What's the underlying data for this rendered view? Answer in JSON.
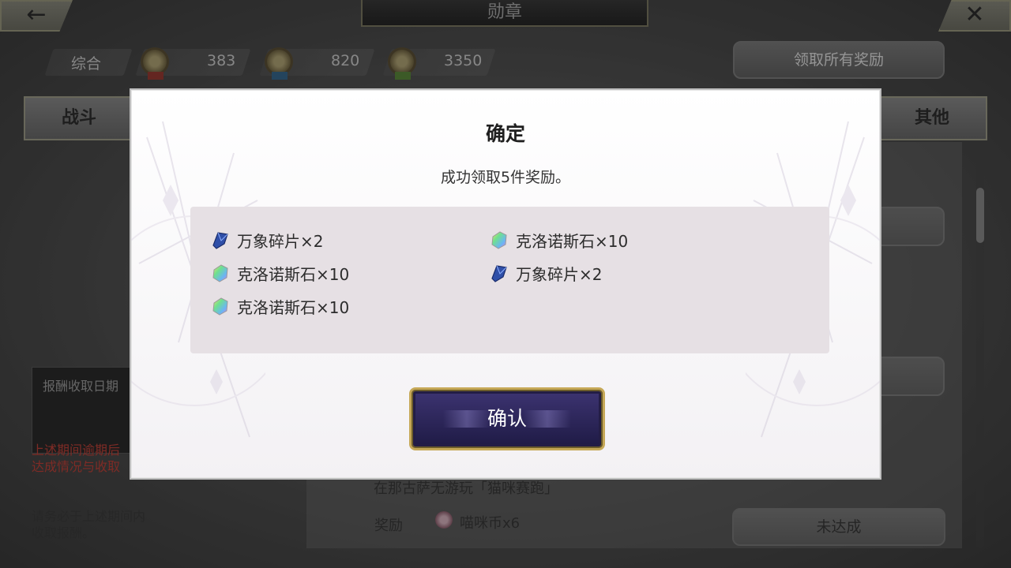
{
  "header": {
    "title": "勋章",
    "back_icon": "←",
    "close_icon": "✕"
  },
  "stats": {
    "label": "综合",
    "medals": [
      {
        "color": "red",
        "value": "383"
      },
      {
        "color": "blue",
        "value": "820"
      },
      {
        "color": "green",
        "value": "3350"
      }
    ]
  },
  "claim_all_label": "领取所有奖励",
  "tabs": {
    "battle": "战斗",
    "other": "其他"
  },
  "left_panel": {
    "box_label": "报酬收取日期",
    "warning_line1": "上述期间逾期后",
    "warning_line2": "达成情况与收取",
    "note_line1": "请务必于上述期间内",
    "note_line2": "收取报酬。"
  },
  "list": {
    "item_text": "在那古萨无游玩「猫咪赛跑」",
    "reward_label": "奖励",
    "reward_value": "喵咪币x6",
    "status_label": "未达成"
  },
  "modal": {
    "title": "确定",
    "message": "成功领取5件奖励。",
    "rewards": [
      {
        "name": "万象碎片×2",
        "icon": "blue-shard-icon"
      },
      {
        "name": "克洛诺斯石×10",
        "icon": "rainbow-crystal-icon"
      },
      {
        "name": "克洛诺斯石×10",
        "icon": "rainbow-crystal-icon"
      },
      {
        "name": "万象碎片×2",
        "icon": "blue-shard-icon"
      },
      {
        "name": "克洛诺斯石×10",
        "icon": "rainbow-crystal-icon"
      }
    ],
    "confirm_label": "确认"
  },
  "colors": {
    "accent_gold": "#c6a857",
    "button_purple": "#2d2660",
    "warning_red": "#c2423a"
  }
}
